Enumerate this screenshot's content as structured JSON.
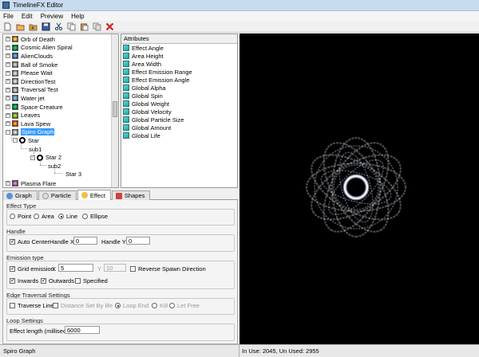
{
  "window": {
    "title": "TimelineFX Editor"
  },
  "menu": [
    "File",
    "Edit",
    "Preview",
    "Help"
  ],
  "toolbar": [
    "new-icon",
    "open-icon",
    "import-icon",
    "save-icon",
    "cut-icon",
    "copy-icon",
    "paste-icon",
    "clone-icon",
    "delete-icon"
  ],
  "tree": {
    "effects": [
      {
        "label": "Orb of Death",
        "thumb": "orb"
      },
      {
        "label": "Cosmic Alien Spiral",
        "thumb": "alien"
      },
      {
        "label": "AlienClouds",
        "thumb": "clouds"
      },
      {
        "label": "Ball of Smoke",
        "thumb": "smoke"
      },
      {
        "label": "Please Wait",
        "thumb": "wait"
      },
      {
        "label": "DirectionTest",
        "thumb": "wait"
      },
      {
        "label": "Traversal Test",
        "thumb": "smoke"
      },
      {
        "label": "Water jet",
        "thumb": "water"
      },
      {
        "label": "Space Creature",
        "thumb": "alien"
      },
      {
        "label": "Leaves",
        "thumb": "leaves"
      },
      {
        "label": "Lava Spew",
        "thumb": "lava"
      },
      {
        "label": "Spiro Graph",
        "thumb": "wait"
      }
    ],
    "children": [
      {
        "label": "Star",
        "indent": 1
      },
      {
        "label": "sub1",
        "indent": 2
      },
      {
        "label": "Star 2",
        "indent": 3
      },
      {
        "label": "sub2",
        "indent": 4
      },
      {
        "label": "Star 3",
        "indent": 5
      }
    ],
    "last": {
      "label": "Plasma Flare",
      "thumb": "plasma"
    }
  },
  "attributes": {
    "header": "Attributes",
    "items": [
      "Effect Angle",
      "Area Height",
      "Area Width",
      "Effect Emission Range",
      "Effect Emission Angle",
      "Global Alpha",
      "Global Spin",
      "Global Weight",
      "Global Velocity",
      "Global Particle Size",
      "Global Amount",
      "Global Life"
    ]
  },
  "tabs": [
    {
      "label": "Graph",
      "color": "#5a8fd8"
    },
    {
      "label": "Particle",
      "color": "#dddddd"
    },
    {
      "label": "Effect",
      "color": "#f0c040"
    },
    {
      "label": "Shapes",
      "color": "#d04040"
    }
  ],
  "effect": {
    "effect_type": {
      "title": "Effect Type",
      "options": [
        "Point",
        "Area",
        "Line",
        "Ellipse"
      ],
      "selected": "Line"
    },
    "handle": {
      "title": "Handle",
      "auto_center": "Auto Center",
      "handle_x_label": "Handle X",
      "handle_x": "0",
      "handle_y_label": "Handle Y",
      "handle_y": "0"
    },
    "emission": {
      "title": "Emission type",
      "grid_emission": "Grid emission",
      "x_label": "X",
      "x_value": "5",
      "y_label": "Y",
      "y_value": "10",
      "reverse_spawn": "Reverse Spawn Direction",
      "inwards": "Inwards",
      "outwards": "Outwards",
      "specified": "Specified"
    },
    "edge": {
      "title": "Edge Traversal Settings",
      "traverse_line": "Traverse Line",
      "distance_set": "Distance Set By life",
      "loop_end": "Loop End",
      "kill": "Kill",
      "let_free": "Let Free"
    },
    "loop": {
      "title": "Loop Settings",
      "effect_length_label": "Effect length (millisecs)",
      "effect_length": "6000"
    }
  },
  "status": {
    "left": "Spiro Graph",
    "right": "In Use: 2045, Un Used: 2955"
  },
  "colors": {
    "selection": "#3399ff",
    "viewport_bg": "#000000",
    "delete": "#cc2222"
  }
}
